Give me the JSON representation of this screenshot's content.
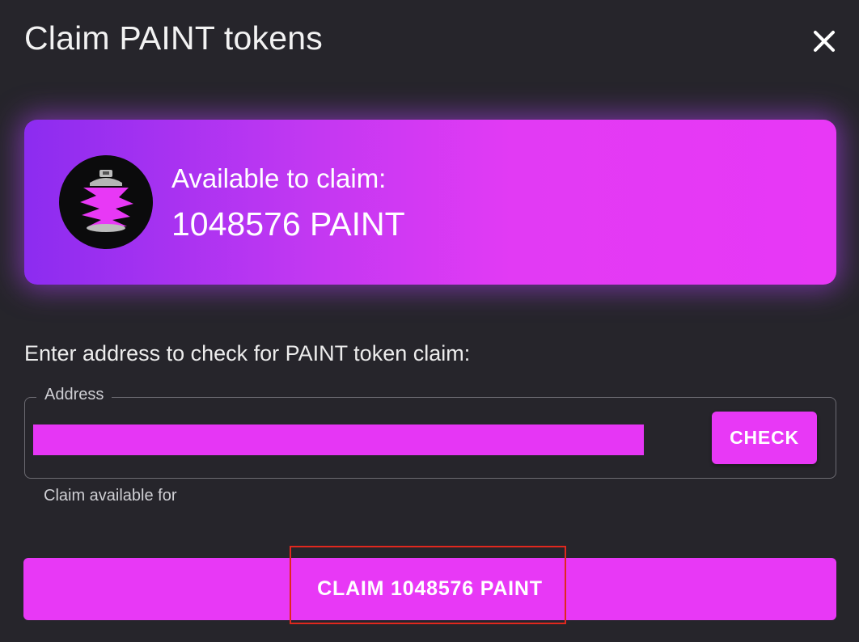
{
  "dialog": {
    "title": "Claim PAINT tokens",
    "close_icon": "close-icon"
  },
  "card": {
    "label": "Available to claim:",
    "amount": "1048576 PAINT",
    "logo_icon": "spray-can-icon",
    "gradient_start": "#8c2cf0",
    "gradient_end": "#e838f6"
  },
  "form": {
    "prompt": "Enter address to check for PAINT token claim:",
    "address_legend": "Address",
    "address_value": "",
    "check_label": "CHECK",
    "helper_text": "Claim available for"
  },
  "claim": {
    "button_label": "CLAIM 1048576 PAINT"
  },
  "colors": {
    "background": "#26252b",
    "accent": "#e838f6",
    "highlight": "#e0281e"
  }
}
